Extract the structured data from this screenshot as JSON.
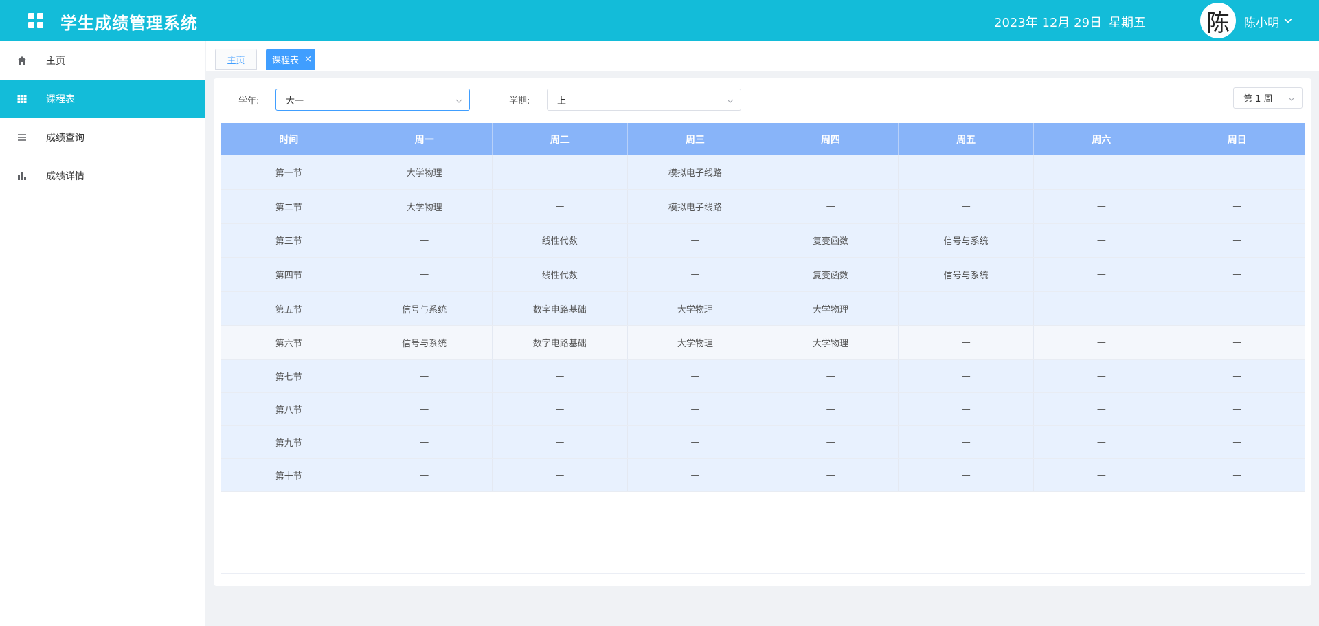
{
  "header": {
    "app_title": "学生成绩管理系统",
    "date": "2023年 12月 29日",
    "weekday": "星期五",
    "avatar_char": "陈",
    "user_name": "陈小明"
  },
  "sidebar": {
    "items": [
      {
        "label": "主页",
        "icon": "home-icon"
      },
      {
        "label": "课程表",
        "icon": "grid-icon"
      },
      {
        "label": "成绩查询",
        "icon": "list-icon"
      },
      {
        "label": "成绩详情",
        "icon": "bar-chart-icon"
      }
    ],
    "active_index": 1
  },
  "tabs": [
    {
      "label": "主页",
      "closable": false
    },
    {
      "label": "课程表",
      "closable": true,
      "close_glyph": "×"
    }
  ],
  "filters": {
    "year_label": "学年:",
    "year_value": "大一",
    "term_label": "学期:",
    "term_value": "上",
    "week_value": "第 1 周"
  },
  "schedule": {
    "columns": [
      "时间",
      "周一",
      "周二",
      "周三",
      "周四",
      "周五",
      "周六",
      "周日"
    ],
    "rows": [
      [
        "第一节",
        "大学物理",
        "—",
        "模拟电子线路",
        "—",
        "—",
        "—",
        "—"
      ],
      [
        "第二节",
        "大学物理",
        "—",
        "模拟电子线路",
        "—",
        "—",
        "—",
        "—"
      ],
      [
        "第三节",
        "—",
        "线性代数",
        "—",
        "复变函数",
        "信号与系统",
        "—",
        "—"
      ],
      [
        "第四节",
        "—",
        "线性代数",
        "—",
        "复变函数",
        "信号与系统",
        "—",
        "—"
      ],
      [
        "第五节",
        "信号与系统",
        "数字电路基础",
        "大学物理",
        "大学物理",
        "—",
        "—",
        "—"
      ],
      [
        "第六节",
        "信号与系统",
        "数字电路基础",
        "大学物理",
        "大学物理",
        "—",
        "—",
        "—"
      ],
      [
        "第七节",
        "—",
        "—",
        "—",
        "—",
        "—",
        "—",
        "—"
      ],
      [
        "第八节",
        "—",
        "—",
        "—",
        "—",
        "—",
        "—",
        "—"
      ],
      [
        "第九节",
        "—",
        "—",
        "—",
        "—",
        "—",
        "—",
        "—"
      ],
      [
        "第十节",
        "—",
        "—",
        "—",
        "—",
        "—",
        "—",
        "—"
      ]
    ]
  },
  "colors": {
    "header_bg": "#13bcd9",
    "table_header_bg": "#88b4f9",
    "row_bg": "#e8f1fe",
    "accent": "#409eff"
  }
}
